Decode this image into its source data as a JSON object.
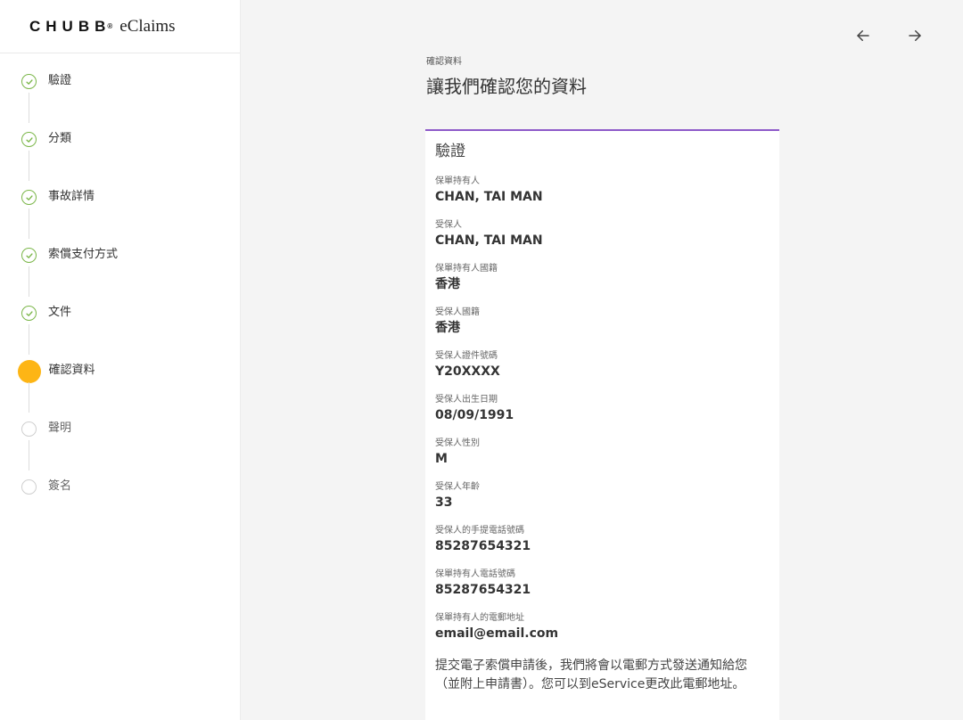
{
  "brand": {
    "logo": "CHUBB",
    "registered": "®",
    "app_name": "eClaims"
  },
  "sidebar": {
    "steps": [
      {
        "label": "驗證",
        "status": "done"
      },
      {
        "label": "分類",
        "status": "done"
      },
      {
        "label": "事故詳情",
        "status": "done"
      },
      {
        "label": "索償支付方式",
        "status": "done"
      },
      {
        "label": "文件",
        "status": "done"
      },
      {
        "label": "確認資料",
        "status": "current"
      },
      {
        "label": "聲明",
        "status": "todo"
      },
      {
        "label": "簽名",
        "status": "todo"
      }
    ]
  },
  "nav": {
    "back_icon": "arrow-left-icon",
    "forward_icon": "arrow-right-icon"
  },
  "header": {
    "breadcrumb": "確認資料",
    "title": "讓我們確認您的資料"
  },
  "card": {
    "title": "驗證",
    "fields": [
      {
        "label": "保單持有人",
        "value": "CHAN, TAI MAN"
      },
      {
        "label": "受保人",
        "value": "CHAN, TAI MAN"
      },
      {
        "label": "保單持有人國籍",
        "value": "香港"
      },
      {
        "label": "受保人國籍",
        "value": "香港"
      },
      {
        "label": "受保人證件號碼",
        "value": "Y20XXXX"
      },
      {
        "label": "受保人出生日期",
        "value": "08/09/1991"
      },
      {
        "label": "受保人性別",
        "value": "M"
      },
      {
        "label": "受保人年齡",
        "value": "33"
      },
      {
        "label": "受保人的手提電話號碼",
        "value": "85287654321"
      },
      {
        "label": "保單持有人電話號碼",
        "value": "85287654321"
      },
      {
        "label": "保單持有人的電郵地址",
        "value": "email@email.com"
      }
    ],
    "notice": "提交電子索償申請後，我們將會以電郵方式發送通知給您（並附上申請書）。您可以到eService更改此電郵地址。"
  },
  "colors": {
    "done": "#7ab648",
    "current": "#fdb515",
    "accent_border": "#8e5ac9"
  }
}
